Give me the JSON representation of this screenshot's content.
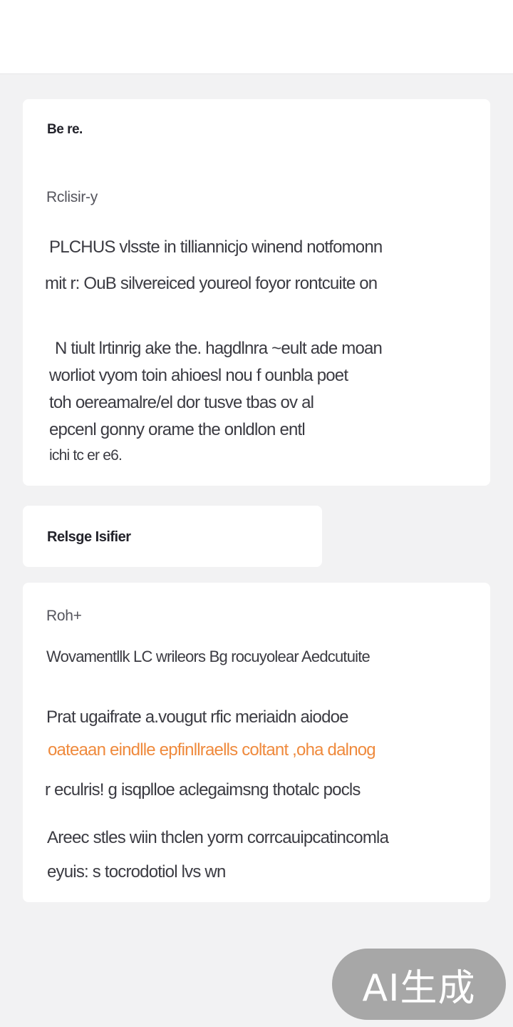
{
  "card1": {
    "title": "Be re.",
    "section_label": "Rclisir-y",
    "para1": [
      "PLCHUS vlsste in tilliannicjo winend notfomonn",
      "mit r: OuB silvereiced youreol foyor rontcuite on"
    ],
    "para2": [
      "N tiult lrtinrig ake the. hagdlnra ~eult ade moan",
      "worliot vyom toin ahioesl nou f ounbla poet",
      "toh oereamalre/el dor tusve tbas ov al",
      "epcenl gonny orame the onldlon entl",
      "ichi tc er e6."
    ]
  },
  "card2": {
    "title": "Relsge Isifier"
  },
  "card3": {
    "section_label": "Roh+",
    "subtitle": "Wovamentllk LC wrileors Bg rocuyolear Aedcutuite",
    "para1_line1": "Prat ugaifrate a.vougut rfic meriaidn aiodoe",
    "para1_accent": "oateaan eindlle epfinllraells coltant ,oha dalnog",
    "para1_line3": "r eculris! g isqplloe aclegaimsng thotalc pocls",
    "para2": [
      "Areec stles wiin thclen yorm corrcauipcatincomla",
      "eyuis: s tocrodotiol lvs wn"
    ]
  },
  "badge": {
    "label": "AI生成"
  },
  "colors": {
    "accent": "#ef8a3d",
    "background": "#f2f2f3",
    "card": "#ffffff",
    "badge": "#969696"
  }
}
